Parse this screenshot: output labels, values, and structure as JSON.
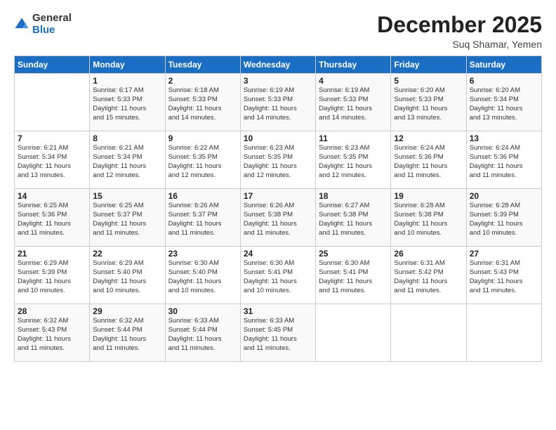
{
  "logo": {
    "general": "General",
    "blue": "Blue"
  },
  "header": {
    "month": "December 2025",
    "location": "Suq Shamar, Yemen"
  },
  "weekdays": [
    "Sunday",
    "Monday",
    "Tuesday",
    "Wednesday",
    "Thursday",
    "Friday",
    "Saturday"
  ],
  "weeks": [
    [
      {
        "day": "",
        "info": ""
      },
      {
        "day": "1",
        "info": "Sunrise: 6:17 AM\nSunset: 5:33 PM\nDaylight: 11 hours\nand 15 minutes."
      },
      {
        "day": "2",
        "info": "Sunrise: 6:18 AM\nSunset: 5:33 PM\nDaylight: 11 hours\nand 14 minutes."
      },
      {
        "day": "3",
        "info": "Sunrise: 6:19 AM\nSunset: 5:33 PM\nDaylight: 11 hours\nand 14 minutes."
      },
      {
        "day": "4",
        "info": "Sunrise: 6:19 AM\nSunset: 5:33 PM\nDaylight: 11 hours\nand 14 minutes."
      },
      {
        "day": "5",
        "info": "Sunrise: 6:20 AM\nSunset: 5:33 PM\nDaylight: 11 hours\nand 13 minutes."
      },
      {
        "day": "6",
        "info": "Sunrise: 6:20 AM\nSunset: 5:34 PM\nDaylight: 11 hours\nand 13 minutes."
      }
    ],
    [
      {
        "day": "7",
        "info": "Sunrise: 6:21 AM\nSunset: 5:34 PM\nDaylight: 11 hours\nand 13 minutes."
      },
      {
        "day": "8",
        "info": "Sunrise: 6:21 AM\nSunset: 5:34 PM\nDaylight: 11 hours\nand 12 minutes."
      },
      {
        "day": "9",
        "info": "Sunrise: 6:22 AM\nSunset: 5:35 PM\nDaylight: 11 hours\nand 12 minutes."
      },
      {
        "day": "10",
        "info": "Sunrise: 6:23 AM\nSunset: 5:35 PM\nDaylight: 11 hours\nand 12 minutes."
      },
      {
        "day": "11",
        "info": "Sunrise: 6:23 AM\nSunset: 5:35 PM\nDaylight: 11 hours\nand 12 minutes."
      },
      {
        "day": "12",
        "info": "Sunrise: 6:24 AM\nSunset: 5:36 PM\nDaylight: 11 hours\nand 11 minutes."
      },
      {
        "day": "13",
        "info": "Sunrise: 6:24 AM\nSunset: 5:36 PM\nDaylight: 11 hours\nand 11 minutes."
      }
    ],
    [
      {
        "day": "14",
        "info": "Sunrise: 6:25 AM\nSunset: 5:36 PM\nDaylight: 11 hours\nand 11 minutes."
      },
      {
        "day": "15",
        "info": "Sunrise: 6:25 AM\nSunset: 5:37 PM\nDaylight: 11 hours\nand 11 minutes."
      },
      {
        "day": "16",
        "info": "Sunrise: 6:26 AM\nSunset: 5:37 PM\nDaylight: 11 hours\nand 11 minutes."
      },
      {
        "day": "17",
        "info": "Sunrise: 6:26 AM\nSunset: 5:38 PM\nDaylight: 11 hours\nand 11 minutes."
      },
      {
        "day": "18",
        "info": "Sunrise: 6:27 AM\nSunset: 5:38 PM\nDaylight: 11 hours\nand 11 minutes."
      },
      {
        "day": "19",
        "info": "Sunrise: 6:28 AM\nSunset: 5:38 PM\nDaylight: 11 hours\nand 10 minutes."
      },
      {
        "day": "20",
        "info": "Sunrise: 6:28 AM\nSunset: 5:39 PM\nDaylight: 11 hours\nand 10 minutes."
      }
    ],
    [
      {
        "day": "21",
        "info": "Sunrise: 6:29 AM\nSunset: 5:39 PM\nDaylight: 11 hours\nand 10 minutes."
      },
      {
        "day": "22",
        "info": "Sunrise: 6:29 AM\nSunset: 5:40 PM\nDaylight: 11 hours\nand 10 minutes."
      },
      {
        "day": "23",
        "info": "Sunrise: 6:30 AM\nSunset: 5:40 PM\nDaylight: 11 hours\nand 10 minutes."
      },
      {
        "day": "24",
        "info": "Sunrise: 6:30 AM\nSunset: 5:41 PM\nDaylight: 11 hours\nand 10 minutes."
      },
      {
        "day": "25",
        "info": "Sunrise: 6:30 AM\nSunset: 5:41 PM\nDaylight: 11 hours\nand 11 minutes."
      },
      {
        "day": "26",
        "info": "Sunrise: 6:31 AM\nSunset: 5:42 PM\nDaylight: 11 hours\nand 11 minutes."
      },
      {
        "day": "27",
        "info": "Sunrise: 6:31 AM\nSunset: 5:43 PM\nDaylight: 11 hours\nand 11 minutes."
      }
    ],
    [
      {
        "day": "28",
        "info": "Sunrise: 6:32 AM\nSunset: 5:43 PM\nDaylight: 11 hours\nand 11 minutes."
      },
      {
        "day": "29",
        "info": "Sunrise: 6:32 AM\nSunset: 5:44 PM\nDaylight: 11 hours\nand 11 minutes."
      },
      {
        "day": "30",
        "info": "Sunrise: 6:33 AM\nSunset: 5:44 PM\nDaylight: 11 hours\nand 11 minutes."
      },
      {
        "day": "31",
        "info": "Sunrise: 6:33 AM\nSunset: 5:45 PM\nDaylight: 11 hours\nand 11 minutes."
      },
      {
        "day": "",
        "info": ""
      },
      {
        "day": "",
        "info": ""
      },
      {
        "day": "",
        "info": ""
      }
    ]
  ]
}
